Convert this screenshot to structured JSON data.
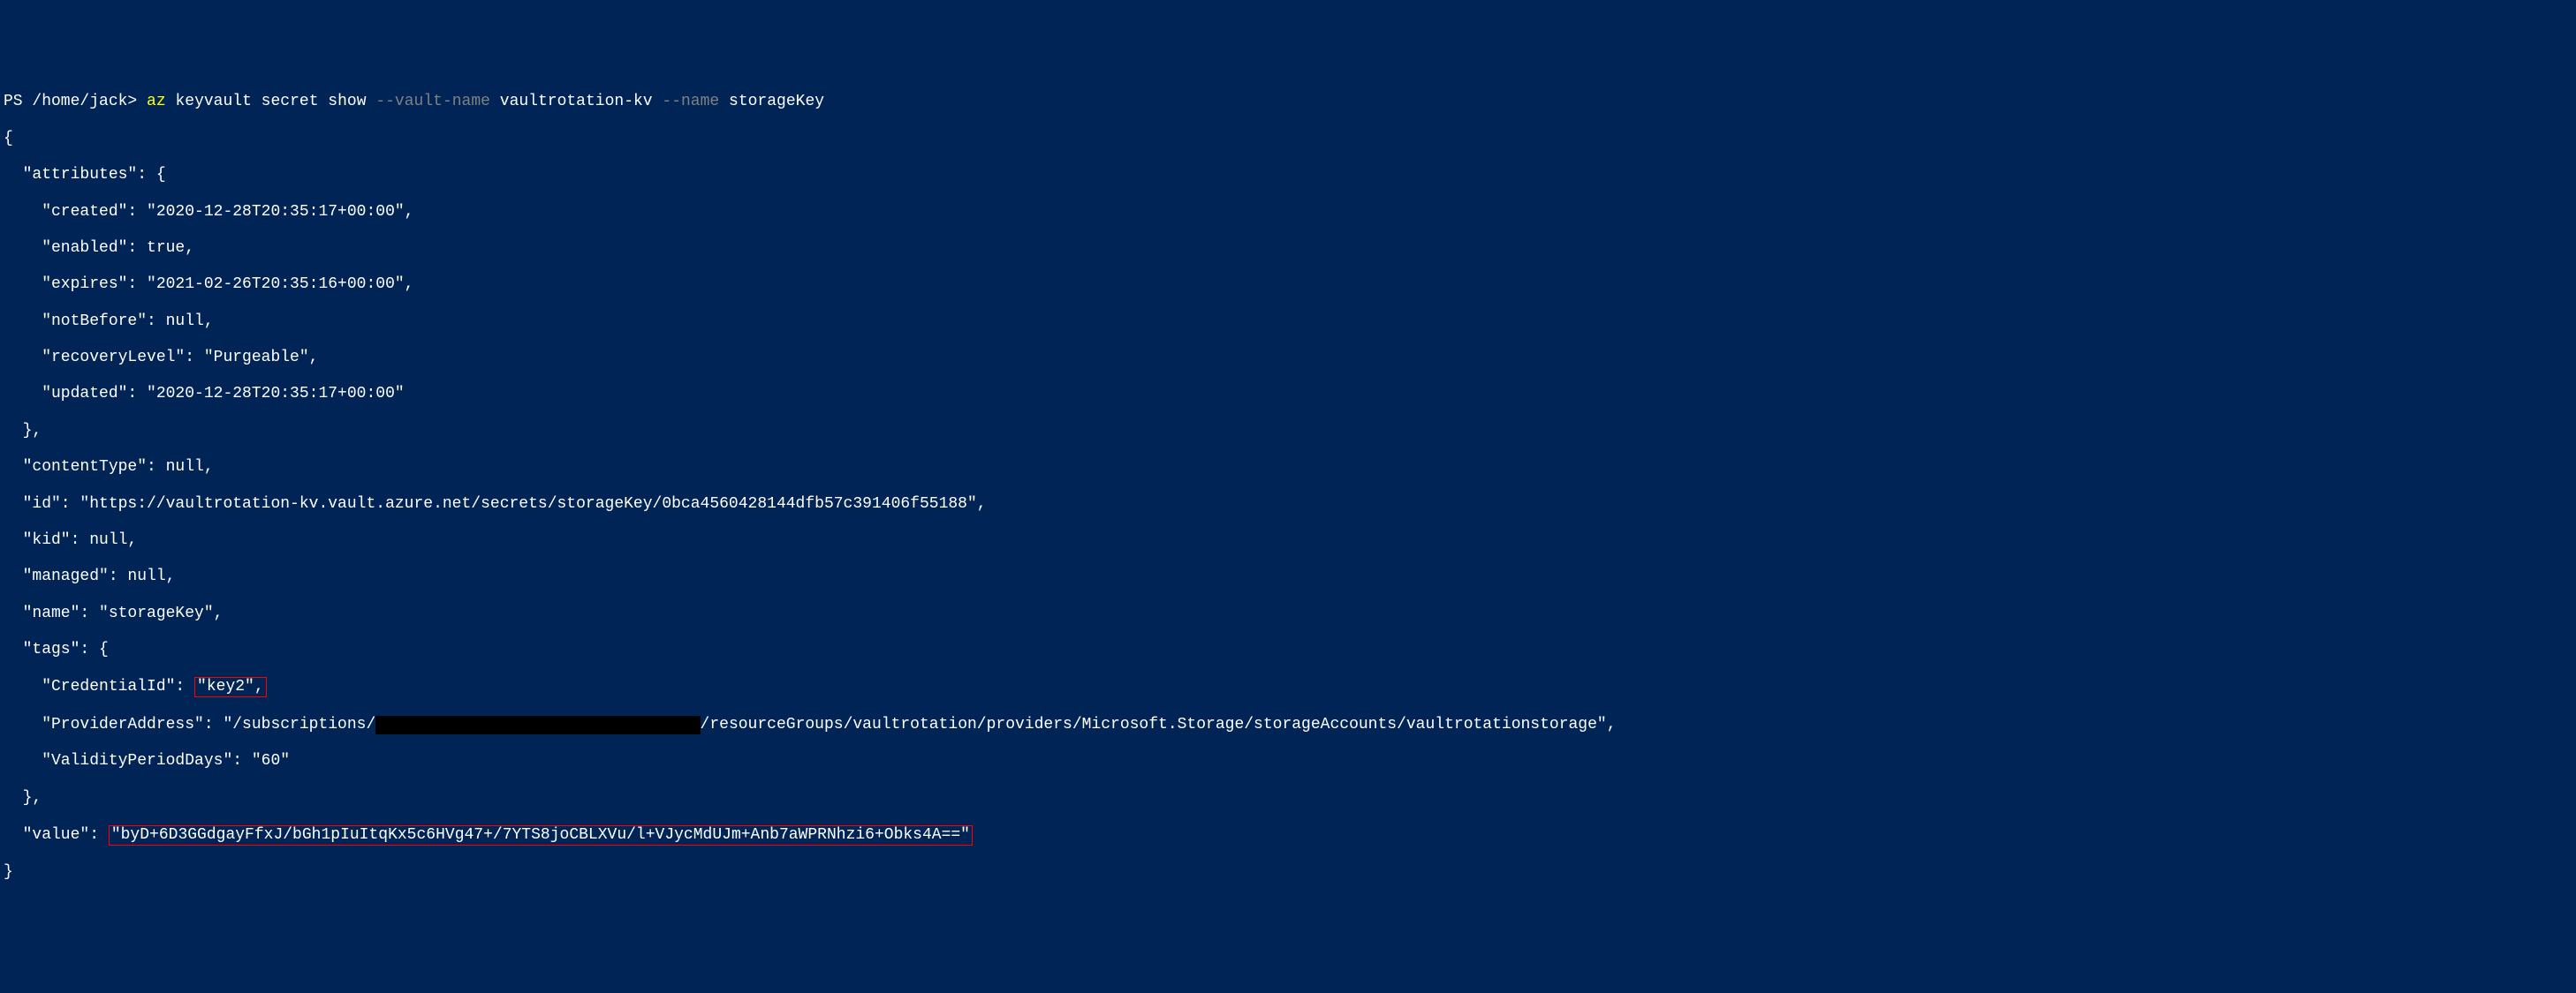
{
  "prompt": {
    "prefix": "PS /home/jack>",
    "cmd_az": "az",
    "cmd_rest": "keyvault secret show",
    "flag_vault": "--vault-name",
    "val_vault": "vaultrotation-kv",
    "flag_name": "--name",
    "val_name": "storageKey"
  },
  "json": {
    "open": "{",
    "attributes_key": "  \"attributes\": {",
    "created": "    \"created\": \"2020-12-28T20:35:17+00:00\",",
    "enabled": "    \"enabled\": true,",
    "expires": "    \"expires\": \"2021-02-26T20:35:16+00:00\",",
    "notBefore": "    \"notBefore\": null,",
    "recoveryLevel": "    \"recoveryLevel\": \"Purgeable\",",
    "updated": "    \"updated\": \"2020-12-28T20:35:17+00:00\"",
    "attributes_close": "  },",
    "contentType": "  \"contentType\": null,",
    "id": "  \"id\": \"https://vaultrotation-kv.vault.azure.net/secrets/storageKey/0bca4560428144dfb57c391406f55188\",",
    "kid": "  \"kid\": null,",
    "managed": "  \"managed\": null,",
    "name": "  \"name\": \"storageKey\",",
    "tags_key": "  \"tags\": {",
    "credentialId_label": "    \"CredentialId\": ",
    "credentialId_value": "\"key2\",",
    "providerAddress_pre": "    \"ProviderAddress\": \"/subscriptions/",
    "providerAddress_post": "/resourceGroups/vaultrotation/providers/Microsoft.Storage/storageAccounts/vaultrotationstorage\",",
    "validityPeriodDays": "    \"ValidityPeriodDays\": \"60\"",
    "tags_close": "  },",
    "value_label": "  \"value\": ",
    "value_content": "\"byD+6D3GGdgayFfxJ/bGh1pIuItqKx5c6HVg47+/7YTS8joCBLXVu/l+VJycMdUJm+Anb7aWPRNhzi6+Obks4A==\"",
    "close": "}"
  }
}
